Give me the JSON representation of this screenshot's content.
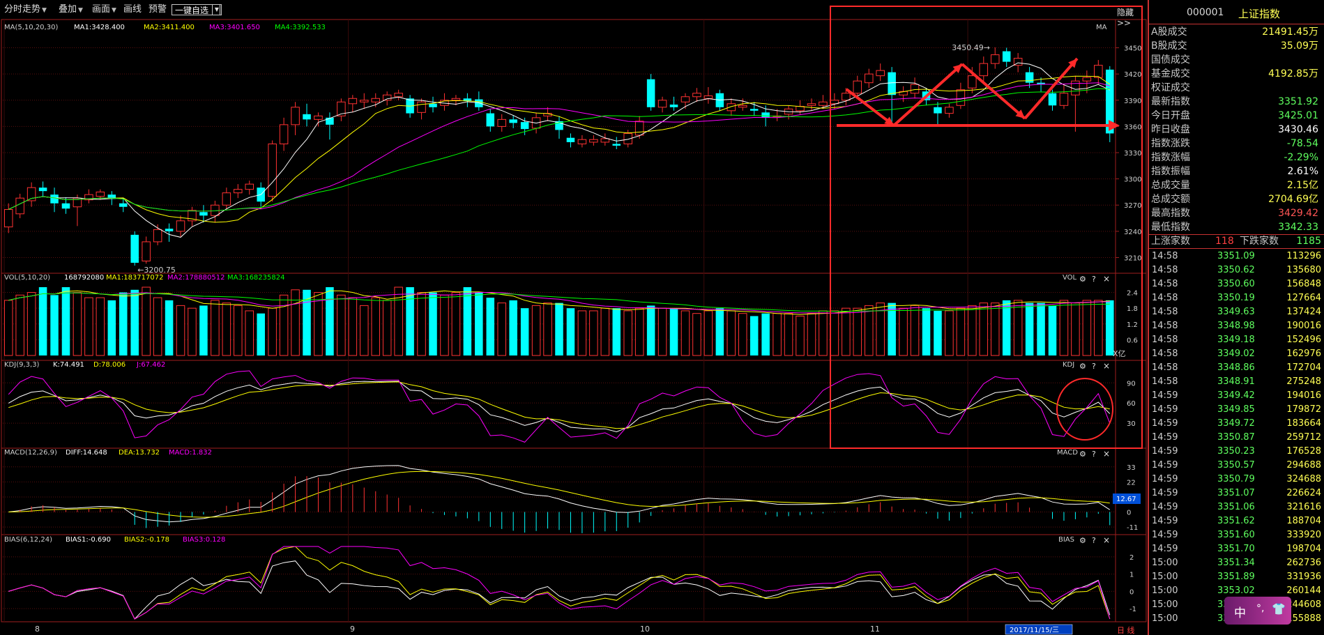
{
  "toolbar": {
    "items": [
      "分时走势",
      "叠加",
      "画面",
      "画线",
      "预警"
    ],
    "watchlist": "一键自选"
  },
  "hide_label": "隐藏>>",
  "ma_panel": {
    "header": "MA(5,10,20,30)",
    "ma1": "MA1:3428.400",
    "ma2": "MA2:3411.400",
    "ma3": "MA3:3401.650",
    "ma4": "MA4:3392.533",
    "tag": "MA",
    "ticks": [
      "3450",
      "3420",
      "3390",
      "3360",
      "3330",
      "3300",
      "3270",
      "3240",
      "3210"
    ],
    "high_label": "3450.49→",
    "low_label": "←3200.75"
  },
  "vol_panel": {
    "header": "VOL(5,10,20)",
    "value": "168792080",
    "ma1": "MA1:183717072",
    "ma2": "MA2:178880512",
    "ma3": "MA3:168235824",
    "tag": "VOL",
    "ticks": [
      "2.4",
      "1.8",
      "1.2",
      "0.6"
    ],
    "unit": "X亿"
  },
  "kdj_panel": {
    "header": "KDJ(9,3,3)",
    "k": "K:74.491",
    "d": "D:78.006",
    "j": "J:67.462",
    "tag": "KDJ",
    "ticks": [
      "90",
      "60",
      "30"
    ]
  },
  "macd_panel": {
    "header": "MACD(12,26,9)",
    "diff": "DIFF:14.648",
    "dea": "DEA:13.732",
    "macd": "MACD:1.832",
    "tag": "MACD",
    "ticks": [
      "33",
      "22",
      "11",
      "0",
      "-11"
    ],
    "current": "12.67"
  },
  "bias_panel": {
    "header": "BIAS(6,12,24)",
    "b1": "BIAS1:-0.690",
    "b2": "BIAS2:-0.178",
    "b3": "BIAS3:0.128",
    "tag": "BIAS",
    "ticks": [
      "2",
      "1",
      "0",
      "-1"
    ]
  },
  "x_axis": {
    "months": [
      "8",
      "9",
      "10",
      "11"
    ],
    "date_box": "2017/11/15/三",
    "day_label": "日 线"
  },
  "panel_icons": {
    "gear": "gear-icon",
    "help": "?",
    "close": "×"
  },
  "right_panel": {
    "code": "000001",
    "name": "上证指数",
    "stats": [
      {
        "label": "A股成交",
        "value": "21491.45万",
        "color": "#ffff55"
      },
      {
        "label": "B股成交",
        "value": "35.09万",
        "color": "#ffff55"
      },
      {
        "label": "国债成交",
        "value": "",
        "color": "#ffff55"
      },
      {
        "label": "基金成交",
        "value": "4192.85万",
        "color": "#ffff55"
      },
      {
        "label": "权证成交",
        "value": "",
        "color": "#ffff55"
      },
      {
        "label": "最新指数",
        "value": "3351.92",
        "color": "#5fff5f"
      },
      {
        "label": "今日开盘",
        "value": "3425.01",
        "color": "#5fff5f"
      },
      {
        "label": "昨日收盘",
        "value": "3430.46",
        "color": "#ffffff"
      },
      {
        "label": "指数涨跌",
        "value": "-78.54",
        "color": "#5fff5f"
      },
      {
        "label": "指数涨幅",
        "value": "-2.29%",
        "color": "#5fff5f"
      },
      {
        "label": "指数振幅",
        "value": "2.61%",
        "color": "#ffffff"
      },
      {
        "label": "总成交量",
        "value": "2.15亿",
        "color": "#ffff55"
      },
      {
        "label": "总成交额",
        "value": "2704.69亿",
        "color": "#ffff55"
      },
      {
        "label": "最高指数",
        "value": "3429.42",
        "color": "#ff5555"
      },
      {
        "label": "最低指数",
        "value": "3342.33",
        "color": "#5fff5f"
      }
    ],
    "adv_label": "上涨家数",
    "adv_value": "118",
    "dec_label": "下跌家数",
    "dec_value": "1185",
    "ticks": [
      {
        "time": "14:58",
        "price": "3351.09",
        "vol": "113296"
      },
      {
        "time": "14:58",
        "price": "3350.62",
        "vol": "135680"
      },
      {
        "time": "14:58",
        "price": "3350.60",
        "vol": "156848"
      },
      {
        "time": "14:58",
        "price": "3350.19",
        "vol": "127664"
      },
      {
        "time": "14:58",
        "price": "3349.63",
        "vol": "137424"
      },
      {
        "time": "14:58",
        "price": "3348.98",
        "vol": "190016"
      },
      {
        "time": "14:58",
        "price": "3349.18",
        "vol": "152496"
      },
      {
        "time": "14:58",
        "price": "3349.02",
        "vol": "162976"
      },
      {
        "time": "14:58",
        "price": "3348.86",
        "vol": "172704"
      },
      {
        "time": "14:58",
        "price": "3348.91",
        "vol": "275248"
      },
      {
        "time": "14:59",
        "price": "3349.42",
        "vol": "194016"
      },
      {
        "time": "14:59",
        "price": "3349.85",
        "vol": "179872"
      },
      {
        "time": "14:59",
        "price": "3349.72",
        "vol": "183664"
      },
      {
        "time": "14:59",
        "price": "3350.87",
        "vol": "259712"
      },
      {
        "time": "14:59",
        "price": "3350.23",
        "vol": "176528"
      },
      {
        "time": "14:59",
        "price": "3350.57",
        "vol": "294688"
      },
      {
        "time": "14:59",
        "price": "3350.79",
        "vol": "324688"
      },
      {
        "time": "14:59",
        "price": "3351.07",
        "vol": "226624"
      },
      {
        "time": "14:59",
        "price": "3351.06",
        "vol": "321616"
      },
      {
        "time": "14:59",
        "price": "3351.62",
        "vol": "188704"
      },
      {
        "time": "14:59",
        "price": "3351.60",
        "vol": "333920"
      },
      {
        "time": "14:59",
        "price": "3351.70",
        "vol": "198704"
      },
      {
        "time": "15:00",
        "price": "3351.34",
        "vol": "262736"
      },
      {
        "time": "15:00",
        "price": "3351.89",
        "vol": "331936"
      },
      {
        "time": "15:00",
        "price": "3353.02",
        "vol": "260144"
      },
      {
        "time": "15:00",
        "price": "3352.15",
        "vol": "244608"
      },
      {
        "time": "15:00",
        "price": "3351.92",
        "vol": "155888"
      }
    ]
  },
  "ime": {
    "label": "中",
    "punct": "°,",
    "shirt": "shirt-icon"
  },
  "colors": {
    "up": "#ff3232",
    "down": "#00ffff",
    "ma1": "#ffffff",
    "ma2": "#ffff00",
    "ma3": "#ff00ff",
    "ma4": "#00ff00",
    "annotation": "#ff2a2a"
  },
  "chart_data": {
    "type": "candlestick",
    "x_months": [
      "8",
      "9",
      "10",
      "11"
    ],
    "price_ylim": [
      3200,
      3460
    ],
    "high_marked": 3450.49,
    "low_marked": 3200.75,
    "candles": [
      {
        "o": 3245,
        "c": 3265,
        "h": 3272,
        "l": 3238
      },
      {
        "o": 3260,
        "c": 3278,
        "h": 3283,
        "l": 3255
      },
      {
        "o": 3275,
        "c": 3290,
        "h": 3296,
        "l": 3268
      },
      {
        "o": 3290,
        "c": 3286,
        "h": 3297,
        "l": 3280
      },
      {
        "o": 3282,
        "c": 3272,
        "h": 3290,
        "l": 3262
      },
      {
        "o": 3272,
        "c": 3266,
        "h": 3279,
        "l": 3260
      },
      {
        "o": 3268,
        "c": 3278,
        "h": 3282,
        "l": 3246
      },
      {
        "o": 3276,
        "c": 3282,
        "h": 3288,
        "l": 3272
      },
      {
        "o": 3280,
        "c": 3285,
        "h": 3288,
        "l": 3276
      },
      {
        "o": 3282,
        "c": 3277,
        "h": 3286,
        "l": 3270
      },
      {
        "o": 3272,
        "c": 3268,
        "h": 3278,
        "l": 3262
      },
      {
        "o": 3236,
        "c": 3204,
        "h": 3240,
        "l": 3200.75
      },
      {
        "o": 3206,
        "c": 3228,
        "h": 3234,
        "l": 3203
      },
      {
        "o": 3228,
        "c": 3242,
        "h": 3248,
        "l": 3224
      },
      {
        "o": 3243,
        "c": 3240,
        "h": 3249,
        "l": 3228
      },
      {
        "o": 3240,
        "c": 3252,
        "h": 3258,
        "l": 3234
      },
      {
        "o": 3252,
        "c": 3264,
        "h": 3268,
        "l": 3246
      },
      {
        "o": 3262,
        "c": 3258,
        "h": 3270,
        "l": 3250
      },
      {
        "o": 3258,
        "c": 3270,
        "h": 3275,
        "l": 3250
      },
      {
        "o": 3270,
        "c": 3284,
        "h": 3290,
        "l": 3266
      },
      {
        "o": 3284,
        "c": 3288,
        "h": 3294,
        "l": 3278
      },
      {
        "o": 3288,
        "c": 3294,
        "h": 3298,
        "l": 3282
      },
      {
        "o": 3290,
        "c": 3274,
        "h": 3296,
        "l": 3268
      },
      {
        "o": 3280,
        "c": 3340,
        "h": 3344,
        "l": 3274
      },
      {
        "o": 3340,
        "c": 3362,
        "h": 3370,
        "l": 3332
      },
      {
        "o": 3362,
        "c": 3382,
        "h": 3388,
        "l": 3350
      },
      {
        "o": 3374,
        "c": 3368,
        "h": 3386,
        "l": 3360
      },
      {
        "o": 3368,
        "c": 3372,
        "h": 3376,
        "l": 3360
      },
      {
        "o": 3370,
        "c": 3362,
        "h": 3376,
        "l": 3345
      },
      {
        "o": 3372,
        "c": 3388,
        "h": 3392,
        "l": 3366
      },
      {
        "o": 3386,
        "c": 3392,
        "h": 3396,
        "l": 3376
      },
      {
        "o": 3388,
        "c": 3390,
        "h": 3398,
        "l": 3380
      },
      {
        "o": 3388,
        "c": 3392,
        "h": 3398,
        "l": 3382
      },
      {
        "o": 3390,
        "c": 3396,
        "h": 3400,
        "l": 3384
      },
      {
        "o": 3394,
        "c": 3398,
        "h": 3402,
        "l": 3390
      },
      {
        "o": 3392,
        "c": 3375,
        "h": 3396,
        "l": 3370
      },
      {
        "o": 3376,
        "c": 3388,
        "h": 3392,
        "l": 3368
      },
      {
        "o": 3386,
        "c": 3382,
        "h": 3394,
        "l": 3376
      },
      {
        "o": 3384,
        "c": 3390,
        "h": 3398,
        "l": 3378
      },
      {
        "o": 3390,
        "c": 3392,
        "h": 3396,
        "l": 3384
      },
      {
        "o": 3392,
        "c": 3389,
        "h": 3398,
        "l": 3382
      },
      {
        "o": 3391,
        "c": 3382,
        "h": 3400,
        "l": 3378
      },
      {
        "o": 3375,
        "c": 3360,
        "h": 3380,
        "l": 3354
      },
      {
        "o": 3360,
        "c": 3368,
        "h": 3374,
        "l": 3354
      },
      {
        "o": 3368,
        "c": 3364,
        "h": 3373,
        "l": 3358
      },
      {
        "o": 3365,
        "c": 3357,
        "h": 3370,
        "l": 3350
      },
      {
        "o": 3358,
        "c": 3370,
        "h": 3376,
        "l": 3352
      },
      {
        "o": 3372,
        "c": 3375,
        "h": 3382,
        "l": 3366
      },
      {
        "o": 3366,
        "c": 3356,
        "h": 3372,
        "l": 3346
      },
      {
        "o": 3347,
        "c": 3342,
        "h": 3352,
        "l": 3336
      },
      {
        "o": 3340,
        "c": 3345,
        "h": 3350,
        "l": 3336
      },
      {
        "o": 3342,
        "c": 3345,
        "h": 3350,
        "l": 3338
      },
      {
        "o": 3342,
        "c": 3346,
        "h": 3352,
        "l": 3338
      },
      {
        "o": 3340,
        "c": 3338,
        "h": 3348,
        "l": 3334
      },
      {
        "o": 3340,
        "c": 3352,
        "h": 3356,
        "l": 3336
      },
      {
        "o": 3350,
        "c": 3366,
        "h": 3372,
        "l": 3346
      },
      {
        "o": 3414,
        "c": 3382,
        "h": 3420,
        "l": 3378
      },
      {
        "o": 3382,
        "c": 3390,
        "h": 3394,
        "l": 3376
      },
      {
        "o": 3385,
        "c": 3382,
        "h": 3394,
        "l": 3378
      },
      {
        "o": 3388,
        "c": 3394,
        "h": 3398,
        "l": 3380
      },
      {
        "o": 3394,
        "c": 3398,
        "h": 3404,
        "l": 3388
      },
      {
        "o": 3392,
        "c": 3395,
        "h": 3405,
        "l": 3386
      },
      {
        "o": 3398,
        "c": 3382,
        "h": 3402,
        "l": 3378
      },
      {
        "o": 3378,
        "c": 3386,
        "h": 3392,
        "l": 3372
      },
      {
        "o": 3382,
        "c": 3384,
        "h": 3392,
        "l": 3378
      },
      {
        "o": 3380,
        "c": 3378,
        "h": 3388,
        "l": 3372
      },
      {
        "o": 3376,
        "c": 3370,
        "h": 3384,
        "l": 3360
      },
      {
        "o": 3372,
        "c": 3372,
        "h": 3380,
        "l": 3366
      },
      {
        "o": 3374,
        "c": 3380,
        "h": 3384,
        "l": 3368
      },
      {
        "o": 3378,
        "c": 3383,
        "h": 3390,
        "l": 3374
      },
      {
        "o": 3384,
        "c": 3386,
        "h": 3392,
        "l": 3378
      },
      {
        "o": 3384,
        "c": 3388,
        "h": 3396,
        "l": 3380
      },
      {
        "o": 3386,
        "c": 3390,
        "h": 3398,
        "l": 3380
      },
      {
        "o": 3390,
        "c": 3398,
        "h": 3404,
        "l": 3384
      },
      {
        "o": 3398,
        "c": 3412,
        "h": 3418,
        "l": 3392
      },
      {
        "o": 3410,
        "c": 3420,
        "h": 3426,
        "l": 3404
      },
      {
        "o": 3418,
        "c": 3424,
        "h": 3432,
        "l": 3412
      },
      {
        "o": 3422,
        "c": 3396,
        "h": 3428,
        "l": 3362
      },
      {
        "o": 3396,
        "c": 3400,
        "h": 3406,
        "l": 3388
      },
      {
        "o": 3398,
        "c": 3408,
        "h": 3416,
        "l": 3392
      },
      {
        "o": 3400,
        "c": 3390,
        "h": 3404,
        "l": 3384
      },
      {
        "o": 3382,
        "c": 3375,
        "h": 3388,
        "l": 3362
      },
      {
        "o": 3375,
        "c": 3382,
        "h": 3386,
        "l": 3370
      },
      {
        "o": 3384,
        "c": 3402,
        "h": 3410,
        "l": 3380
      },
      {
        "o": 3404,
        "c": 3418,
        "h": 3428,
        "l": 3398
      },
      {
        "o": 3418,
        "c": 3432,
        "h": 3440,
        "l": 3412
      },
      {
        "o": 3432,
        "c": 3442,
        "h": 3450.49,
        "l": 3426
      },
      {
        "o": 3446,
        "c": 3434,
        "h": 3450,
        "l": 3428
      },
      {
        "o": 3430,
        "c": 3438,
        "h": 3444,
        "l": 3422
      },
      {
        "o": 3422,
        "c": 3410,
        "h": 3428,
        "l": 3404
      },
      {
        "o": 3410,
        "c": 3408,
        "h": 3416,
        "l": 3400
      },
      {
        "o": 3398,
        "c": 3384,
        "h": 3402,
        "l": 3378
      },
      {
        "o": 3384,
        "c": 3398,
        "h": 3408,
        "l": 3380
      },
      {
        "o": 3396,
        "c": 3412,
        "h": 3418,
        "l": 3354
      },
      {
        "o": 3412,
        "c": 3416,
        "h": 3424,
        "l": 3398
      },
      {
        "o": 3416,
        "c": 3430,
        "h": 3436,
        "l": 3408
      },
      {
        "o": 3425,
        "c": 3352,
        "h": 3429,
        "l": 3342
      }
    ],
    "volume_ylim": [
      0,
      2.6
    ],
    "volumes": [
      2.1,
      2.3,
      2.4,
      2.6,
      2.3,
      2.6,
      2.4,
      2.2,
      2.2,
      2.1,
      2.4,
      2.5,
      2.6,
      2.2,
      2.1,
      1.9,
      1.8,
      1.9,
      2.1,
      2.0,
      1.9,
      1.7,
      1.6,
      1.8,
      2.3,
      2.5,
      2.5,
      2.4,
      2.6,
      2.3,
      2.2,
      1.9,
      2.2,
      2.1,
      2.6,
      2.6,
      2.4,
      2.4,
      2.3,
      2.4,
      2.6,
      2.4,
      2.2,
      2.0,
      2.1,
      1.8,
      1.9,
      2.0,
      2.0,
      1.8,
      1.7,
      1.7,
      1.8,
      1.8,
      1.7,
      1.8,
      1.9,
      1.8,
      1.8,
      1.7,
      1.6,
      1.7,
      1.8,
      1.7,
      1.6,
      1.5,
      1.6,
      1.6,
      1.6,
      1.5,
      1.6,
      1.7,
      1.7,
      1.8,
      1.8,
      1.9,
      2.0,
      2.0,
      1.8,
      1.9,
      1.8,
      1.7,
      1.7,
      1.8,
      1.9,
      2.0,
      2.0,
      2.1,
      2.1,
      2.0,
      2.0,
      1.9,
      2.1,
      2.0,
      2.1,
      2.1,
      2.1
    ],
    "kdj_ylim": [
      0,
      110
    ],
    "macd_ylim": [
      -13,
      38
    ],
    "bias_ylim": [
      -1.6,
      2.6
    ]
  }
}
